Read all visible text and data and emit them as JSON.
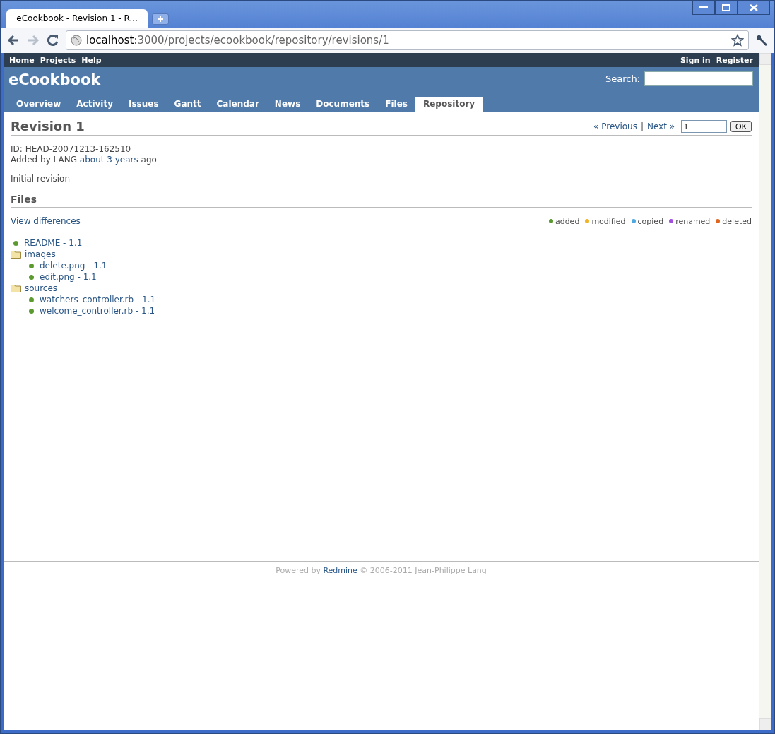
{
  "browser": {
    "tab_title": "eCookbook - Revision 1 - R...",
    "url_host": "localhost",
    "url_path": ":3000/projects/ecookbook/repository/revisions/1"
  },
  "top_menu": {
    "left": [
      "Home",
      "Projects",
      "Help"
    ],
    "right": [
      "Sign in",
      "Register"
    ]
  },
  "header": {
    "project": "eCookbook",
    "search_label": "Search:"
  },
  "tabs": [
    {
      "label": "Overview",
      "selected": false
    },
    {
      "label": "Activity",
      "selected": false
    },
    {
      "label": "Issues",
      "selected": false
    },
    {
      "label": "Gantt",
      "selected": false
    },
    {
      "label": "Calendar",
      "selected": false
    },
    {
      "label": "News",
      "selected": false
    },
    {
      "label": "Documents",
      "selected": false
    },
    {
      "label": "Files",
      "selected": false
    },
    {
      "label": "Repository",
      "selected": true
    }
  ],
  "revision": {
    "title": "Revision 1",
    "previous": "« Previous",
    "separator": "|",
    "next": "Next »",
    "rev_value": "1",
    "ok": "OK",
    "id_line": "ID: HEAD-20071213-162510",
    "added_prefix": "Added by LANG ",
    "added_link": "about 3 years",
    "added_suffix": " ago",
    "comment": "Initial revision"
  },
  "files": {
    "heading": "Files",
    "view_differences": "View differences",
    "legend": [
      {
        "label": "added",
        "color": "#5b9a2f"
      },
      {
        "label": "modified",
        "color": "#f0b429"
      },
      {
        "label": "copied",
        "color": "#4fa8e0"
      },
      {
        "label": "renamed",
        "color": "#a24fe0"
      },
      {
        "label": "deleted",
        "color": "#e0661f"
      }
    ],
    "tree": [
      {
        "kind": "file",
        "label": "README - 1.1",
        "color": "#5b9a2f"
      },
      {
        "kind": "dir",
        "label": "images",
        "children": [
          {
            "kind": "file",
            "label": "delete.png - 1.1",
            "color": "#5b9a2f"
          },
          {
            "kind": "file",
            "label": "edit.png - 1.1",
            "color": "#5b9a2f"
          }
        ]
      },
      {
        "kind": "dir",
        "label": "sources",
        "children": [
          {
            "kind": "file",
            "label": "watchers_controller.rb - 1.1",
            "color": "#5b9a2f"
          },
          {
            "kind": "file",
            "label": "welcome_controller.rb - 1.1",
            "color": "#5b9a2f"
          }
        ]
      }
    ]
  },
  "footer": {
    "prefix": "Powered by ",
    "link": "Redmine",
    "suffix": " © 2006-2011 Jean-Philippe Lang"
  }
}
